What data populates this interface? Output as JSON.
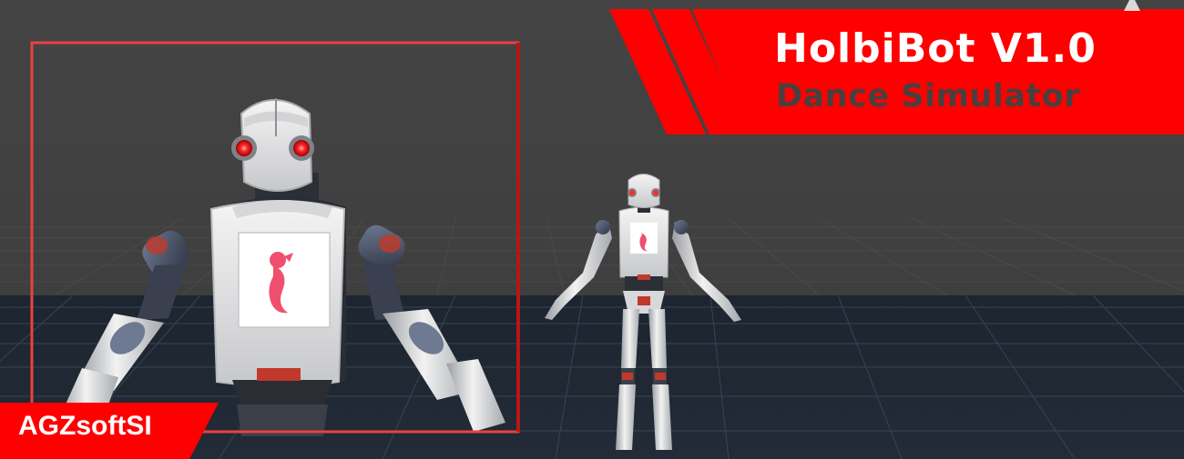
{
  "banner": {
    "title": "HolbiBot V1.0",
    "subtitle": "Dance Simulator"
  },
  "brand": {
    "label": "AGZsoftSI"
  },
  "colors": {
    "accent": "#ff0000",
    "background": "#424242",
    "floor": "#1f2633",
    "robot_body": "#e4e4e4",
    "robot_eyes": "#ff2a2a",
    "emblem": "#f0506e"
  },
  "icons": {
    "emblem": "seahorse-icon"
  }
}
